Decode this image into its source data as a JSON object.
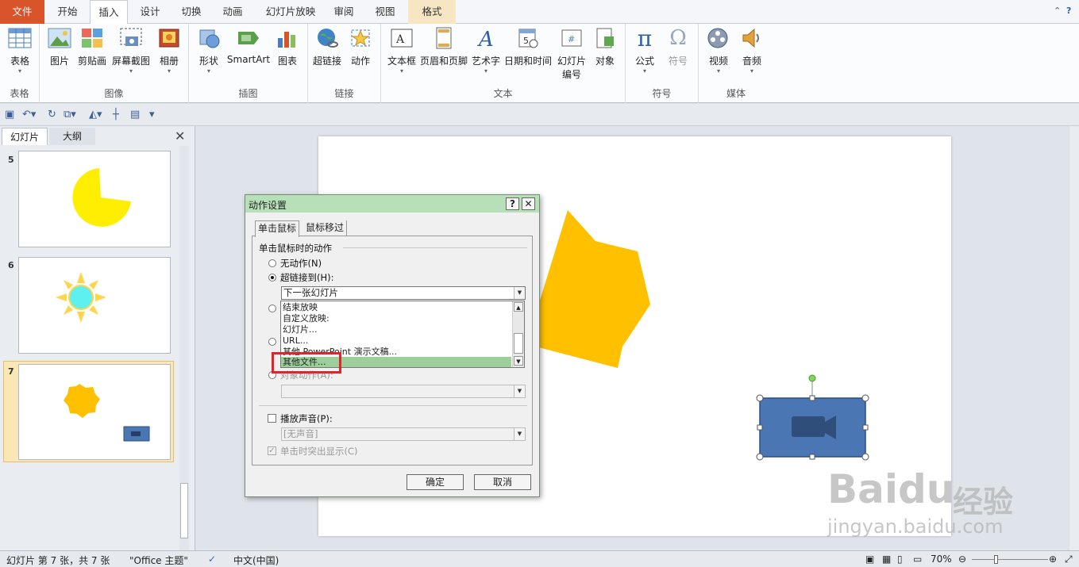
{
  "tabs": [
    "文件",
    "开始",
    "插入",
    "设计",
    "切换",
    "动画",
    "幻灯片放映",
    "审阅",
    "视图",
    "格式"
  ],
  "ribbon": {
    "groups": {
      "table": "表格",
      "image": "图像",
      "illustration": "插图",
      "link": "链接",
      "text": "文本",
      "symbol": "符号",
      "media": "媒体"
    },
    "buttons": {
      "table": "表格",
      "picture": "图片",
      "clipart": "剪贴画",
      "screenshot": "屏幕截图",
      "album": "相册",
      "shapes": "形状",
      "smartart": "SmartArt",
      "chart": "图表",
      "hyperlink": "超链接",
      "action": "动作",
      "textbox": "文本框",
      "headerfooter": "页眉和页脚",
      "wordart": "艺术字",
      "datetime": "日期和时间",
      "slidenum_1": "幻灯片",
      "slidenum_2": "编号",
      "object": "对象",
      "equation": "公式",
      "symbol": "符号",
      "video": "视频",
      "audio": "音频"
    }
  },
  "panel": {
    "tab_slides": "幻灯片",
    "tab_outline": "大纲",
    "slide_numbers": [
      "5",
      "6",
      "7"
    ]
  },
  "dialog": {
    "title": "动作设置",
    "help": "?",
    "close": "✕",
    "tab_click": "单击鼠标",
    "tab_hover": "鼠标移过",
    "section": "单击鼠标时的动作",
    "opt_none": "无动作(N)",
    "opt_hyperlink": "超链接到(H):",
    "hyperlink_value": "下一张幻灯片",
    "list_items": [
      "结束放映",
      "自定义放映:",
      "幻灯片...",
      "URL...",
      "其他 PowerPoint 演示文稿...",
      "其他文件..."
    ],
    "obj_action": "对象动作(A):",
    "play_sound": "播放声音(P):",
    "sound_value": "[无声音]",
    "highlight": "单击时突出显示(C)",
    "ok": "确定",
    "cancel": "取消"
  },
  "status": {
    "slide_info": "幻灯片 第 7 张，共 7 张",
    "theme": "\"Office 主题\"",
    "language": "中文(中国)",
    "zoom": "70%"
  },
  "watermark": {
    "brand": "Baidu",
    "cn": "经验",
    "url": "jingyan.baidu.com"
  },
  "colors": {
    "file_tab": "#d9532b",
    "dialog_title": "#b7e0b8",
    "list_selected": "#9ccf9c",
    "highlight_box": "#e0242a",
    "pacman": "#ffee00",
    "star": "#ffc000",
    "video_shape": "#4a77b4"
  }
}
